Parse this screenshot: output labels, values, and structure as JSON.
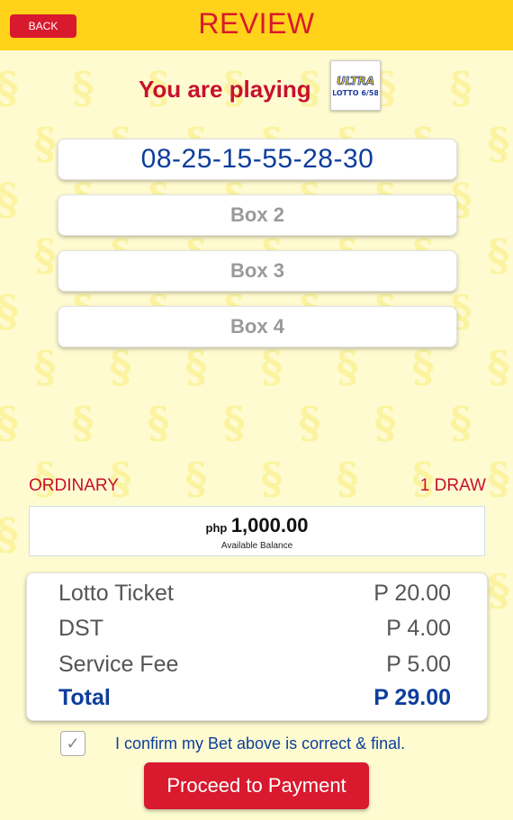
{
  "header": {
    "back_label": "BACK",
    "title": "REVIEW"
  },
  "playing": {
    "label": "You are playing",
    "game_logo_top": "ULTRA",
    "game_logo_bottom": "LOTTO 6/58"
  },
  "boxes": [
    {
      "label": "08-25-15-55-28-30",
      "state": "filled"
    },
    {
      "label": "Box 2",
      "state": "empty"
    },
    {
      "label": "Box 3",
      "state": "empty"
    },
    {
      "label": "Box 4",
      "state": "empty"
    }
  ],
  "bet": {
    "type": "ORDINARY",
    "draws": "1 DRAW"
  },
  "balance": {
    "currency": "php",
    "amount": "1,000.00",
    "caption": "Available Balance"
  },
  "summary": {
    "rows": [
      {
        "label": "Lotto Ticket",
        "value": "P 20.00"
      },
      {
        "label": "DST",
        "value": "P 4.00"
      },
      {
        "label": "Service Fee",
        "value": "P 5.00"
      }
    ],
    "total": {
      "label": "Total",
      "value": "P 29.00"
    }
  },
  "confirm": {
    "checked": true,
    "check_glyph": "✓",
    "text": "I confirm my Bet above is correct & final."
  },
  "proceed_label": "Proceed to Payment",
  "colors": {
    "header_bg": "#ffd31a",
    "accent_red": "#d8192e",
    "brand_blue": "#0d3e9c",
    "page_bg": "#fffbd0"
  },
  "icons": {
    "background": "pcso-logo-watermark",
    "check": "check-icon"
  }
}
